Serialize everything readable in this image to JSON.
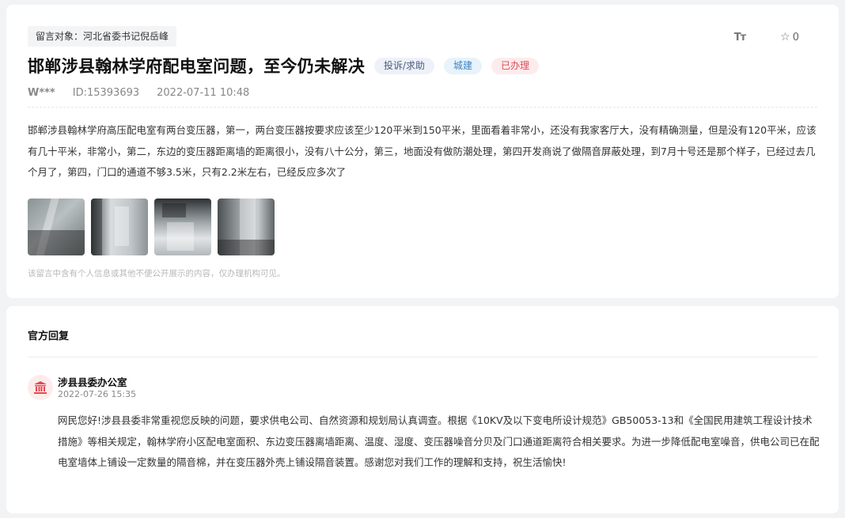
{
  "message": {
    "target_label": "留言对象：河北省委书记倪岳峰",
    "font_size_icon": "Tт",
    "star_icon": "☆",
    "star_count": "0",
    "title": "邯郸涉县翰林学府配电室问题，至今仍未解决",
    "badges": {
      "type": "投诉/求助",
      "category": "城建",
      "status": "已办理"
    },
    "author": "W***",
    "id": "ID:15393693",
    "datetime": "2022-07-11 10:48",
    "content": "邯郸涉县翰林学府高压配电室有两台变压器，第一，两台变压器按要求应该至少120平米到150平米，里面看着非常小，还没有我家客厅大，没有精确测量，但是没有120平米，应该有几十平米，非常小，第二，东边的变压器距离墙的距离很小，没有八十公分，第三，地面没有做防潮处理，第四开发商说了做隔音屏蔽处理，到7月十号还是那个样子，已经过去几个月了，第四，门口的通道不够3.5米，只有2.2米左右，已经反应多次了",
    "notice": "该留言中含有个人信息或其他不便公开展示的内容，仅办理机构可见。"
  },
  "reply": {
    "heading": "官方回复",
    "org_icon": "government-building-icon",
    "org_name": "涉县县委办公室",
    "datetime": "2022-07-26 15:35",
    "content": "网民您好!涉县县委非常重视您反映的问题，要求供电公司、自然资源和规划局认真调查。根据《10KV及以下变电所设计规范》GB50053-13和《全国民用建筑工程设计技术措施》等相关规定，翰林学府小区配电室面积、东边变压器离墙距离、温度、湿度、变压器噪音分贝及门口通道距离符合相关要求。为进一步降低配电室噪音，供电公司已在配电室墙体上铺设一定数量的隔音棉，并在变压器外壳上铺设隔音装置。感谢您对我们工作的理解和支持，祝生活愉快!"
  },
  "colors": {
    "status_red": "#e04a55",
    "category_blue": "#3d84c5",
    "avatar_bg": "#fdecec",
    "avatar_icon": "#e5484d"
  }
}
